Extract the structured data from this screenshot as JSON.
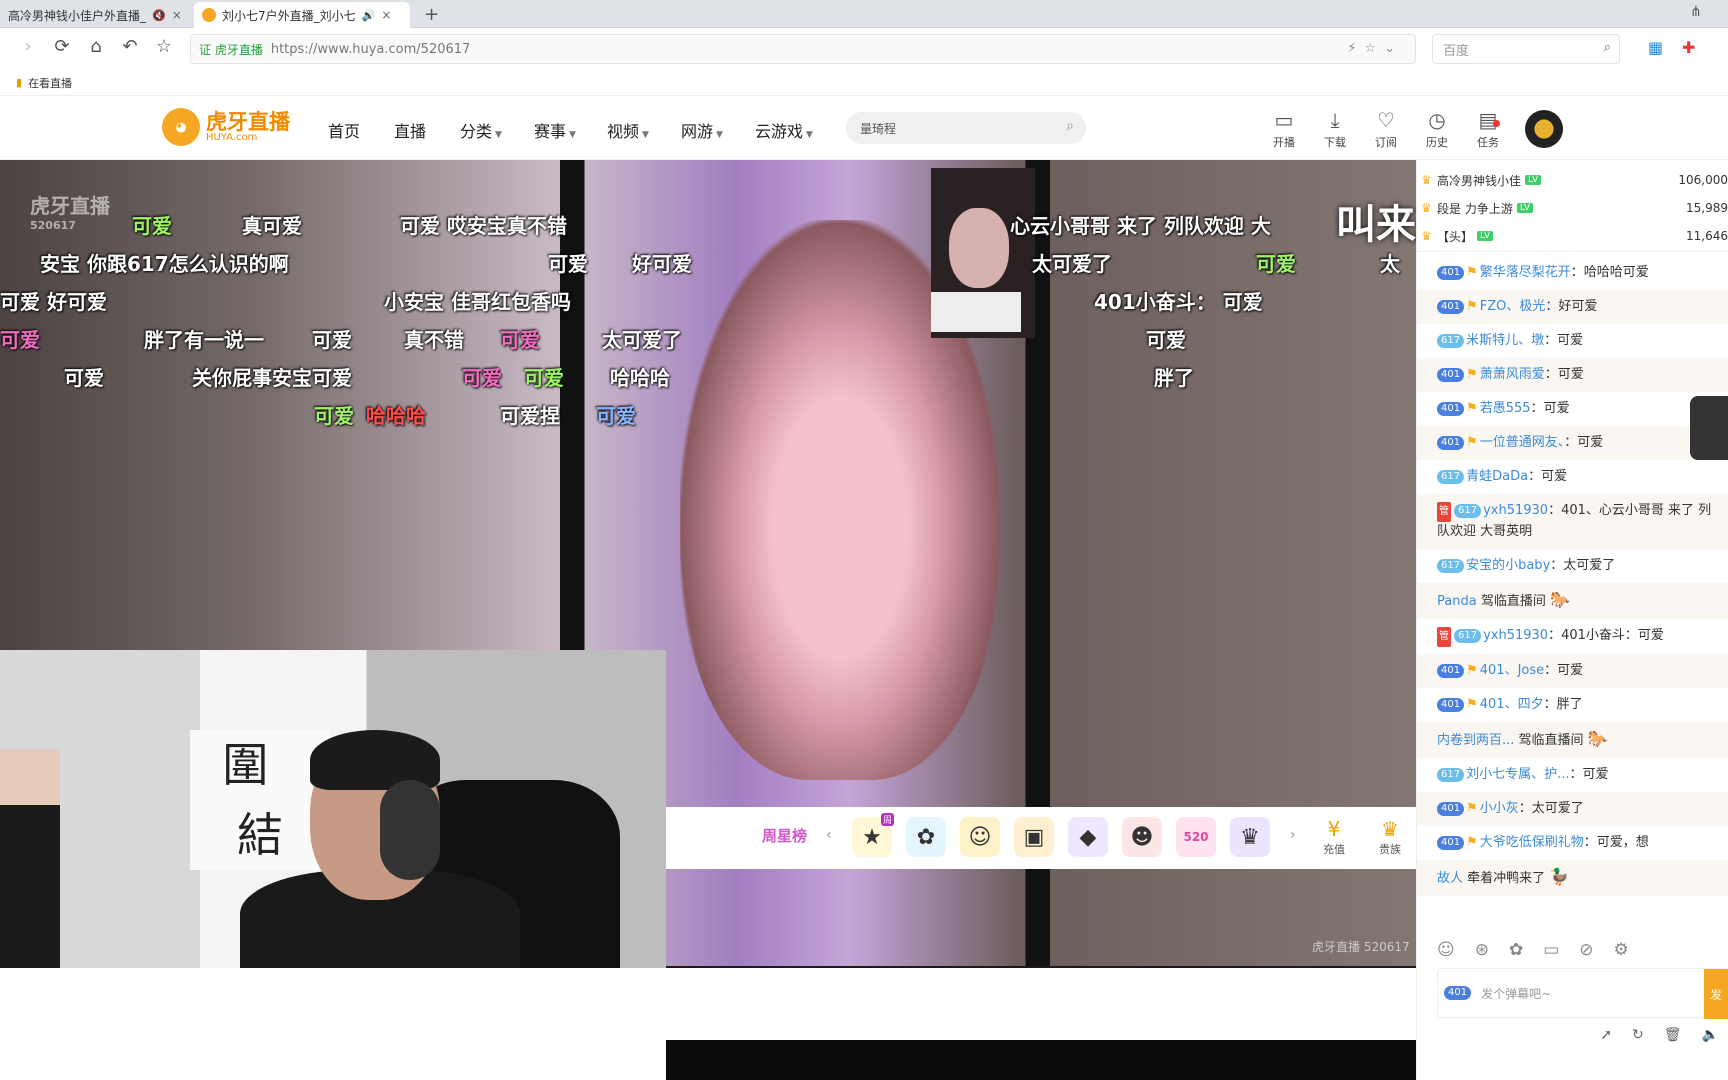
{
  "browser": {
    "tabs": [
      {
        "title": "高冷男神钱小佳户外直播_",
        "active": false
      },
      {
        "title": "刘小七7户外直播_刘小七",
        "active": true
      }
    ],
    "url_cert": "证 虎牙直播",
    "url": "https://www.huya.com/520617",
    "search_engine": "百度",
    "bookmark": "在看直播"
  },
  "site": {
    "logo_main": "虎牙直播",
    "logo_sub": "HUYA.com",
    "menu": [
      "首页",
      "直播",
      "分类",
      "赛事",
      "视频",
      "网游",
      "云游戏"
    ],
    "search_value": "量琦程",
    "header_icons": [
      "开播",
      "下载",
      "订阅",
      "历史",
      "任务"
    ]
  },
  "player": {
    "watermark_top": "虎牙直播",
    "watermark_top_id": "520617",
    "overlay_text": "叫来刷点",
    "watermark_bottom": "虎牙直播 520617",
    "danmaku": [
      {
        "text": "真可爱",
        "color": "w"
      },
      {
        "text": "可爱",
        "color": "g"
      },
      {
        "text": "可爱 哎安宝真不错",
        "color": "w"
      },
      {
        "text": "心云小哥哥 来了 列队欢迎 大",
        "color": "w"
      },
      {
        "text": "安宝 你跟617怎么认识的啊",
        "color": "w"
      },
      {
        "text": "可爱",
        "color": "w"
      },
      {
        "text": "好可爱",
        "color": "w"
      },
      {
        "text": "太可爱了",
        "color": "w"
      },
      {
        "text": "可爱",
        "color": "g"
      },
      {
        "text": "太",
        "color": "w"
      },
      {
        "text": "可爱 好可爱",
        "color": "w"
      },
      {
        "text": "小安宝 佳哥红包香吗",
        "color": "w"
      },
      {
        "text": "401小奋斗： 可爱",
        "color": "w"
      },
      {
        "text": "可爱",
        "color": "p"
      },
      {
        "text": "胖了有一说一",
        "color": "w"
      },
      {
        "text": "可爱",
        "color": "w"
      },
      {
        "text": "真不错",
        "color": "w"
      },
      {
        "text": "可爱",
        "color": "p"
      },
      {
        "text": "太可爱了",
        "color": "w"
      },
      {
        "text": "可爱",
        "color": "w"
      },
      {
        "text": "可爱",
        "color": "w"
      },
      {
        "text": "关你屁事安宝可爱",
        "color": "w"
      },
      {
        "text": "可爱",
        "color": "p"
      },
      {
        "text": "可爱",
        "color": "g"
      },
      {
        "text": "哈哈哈",
        "color": "w"
      },
      {
        "text": "胖了",
        "color": "w"
      },
      {
        "text": "可爱",
        "color": "g"
      },
      {
        "text": "哈哈哈",
        "color": "r"
      },
      {
        "text": "可爱捏",
        "color": "w"
      },
      {
        "text": "可爱",
        "color": "b"
      }
    ]
  },
  "giftbar": {
    "rank_label": "周星榜",
    "gift_tag": "周",
    "gift_number": "520",
    "recharge": "充值",
    "noble": "贵族"
  },
  "chat": {
    "top3": [
      {
        "name": "高冷男神钱小佳",
        "value": "106,000"
      },
      {
        "name": "段是 力争上游",
        "value": "15,989"
      },
      {
        "name": "【头】",
        "value": "11,646"
      }
    ],
    "messages": [
      {
        "badge": "401",
        "nick": "繁华落尽梨花开",
        "text": "：哈哈哈可爱"
      },
      {
        "badge": "401",
        "nick": "FZO、极光",
        "text": "：好可爱"
      },
      {
        "badge": "617",
        "nick": "米斯特儿、墩",
        "text": "：可爱"
      },
      {
        "badge": "401",
        "nick": "萧萧风雨爱",
        "text": "：可爱"
      },
      {
        "badge": "401",
        "nick": "若愚555",
        "text": "：可爱"
      },
      {
        "badge": "401",
        "nick": "一位普通网友、",
        "text": "：可爱"
      },
      {
        "badge": "617",
        "nick": "青蛙DaDa",
        "text": "：可爱"
      },
      {
        "badge": "617",
        "guan": "管",
        "nick": "yxh51930",
        "text": "：401、心云小哥哥 来了 列队欢迎 大哥英明"
      },
      {
        "badge": "617",
        "nick": "安宝的小baby",
        "text": "：太可爱了"
      },
      {
        "nick": "Panda",
        "text": " 驾临直播间",
        "horse": "🐎"
      },
      {
        "badge": "617",
        "guan": "管",
        "nick": "yxh51930",
        "text": "：401小奋斗：可爱"
      },
      {
        "badge": "401",
        "nick": "401、Jose",
        "text": "：可爱"
      },
      {
        "badge": "401",
        "nick": "401、四夕",
        "text": "：胖了"
      },
      {
        "nick": "内卷到两百...",
        "text": " 驾临直播间",
        "horse": "🐎"
      },
      {
        "badge": "617",
        "nick": "刘小七专属、护...",
        "text": "：可爱"
      },
      {
        "badge": "401",
        "nick": "小小灰",
        "text": "：太可爱了"
      },
      {
        "badge": "401",
        "nick": "大爷吃低保刷礼物",
        "text": "：可爱，想"
      },
      {
        "nick": "故人",
        "text": " 牵着冲鸭来了",
        "horse": "🦆"
      }
    ],
    "input_badge": "401",
    "input_placeholder": "发个弹幕吧~",
    "send": "发"
  }
}
